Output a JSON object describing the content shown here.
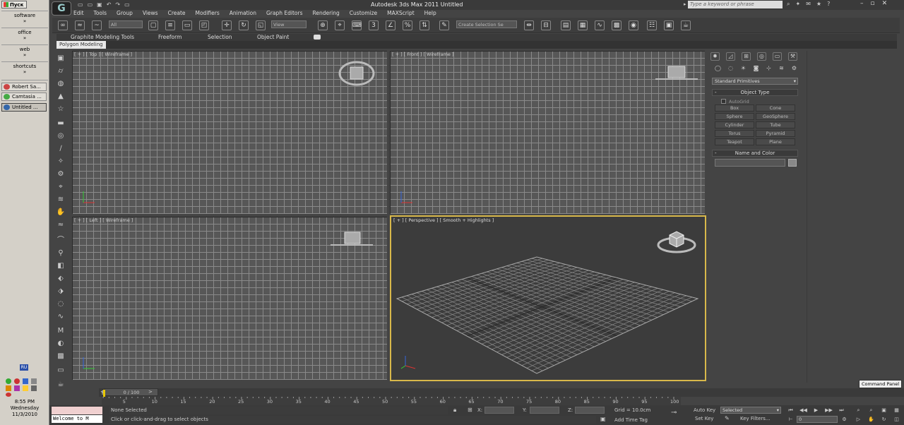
{
  "taskbar": {
    "start_label": "Пуск",
    "groups": [
      {
        "label": "software",
        "chev": "»"
      },
      {
        "label": "office",
        "chev": "»"
      },
      {
        "label": "web",
        "chev": "»"
      },
      {
        "label": "shortcuts",
        "chev": "»"
      }
    ],
    "tasks": [
      {
        "label": "Robert Sa...",
        "color": "#c44"
      },
      {
        "label": "Camtasia ...",
        "color": "#4a4"
      },
      {
        "label": "Untitled ...",
        "color": "#36a"
      }
    ],
    "lang": "RU",
    "time": "8:55 PM",
    "day": "Wednesday",
    "date": "11/3/2010"
  },
  "window": {
    "title": "Autodesk 3ds Max  2011     Untitled",
    "search_placeholder": "Type a keyword or phrase",
    "menu": [
      "Edit",
      "Tools",
      "Group",
      "Views",
      "Create",
      "Modifiers",
      "Animation",
      "Graph Editors",
      "Rendering",
      "Customize",
      "MAXScript",
      "Help"
    ]
  },
  "toolbar": {
    "filter_value": "All",
    "refcoord_value": "View",
    "selset_placeholder": "Create Selection Se"
  },
  "ribbon": {
    "tabs": [
      "Graphite Modeling Tools",
      "Freeform",
      "Selection",
      "Object Paint"
    ],
    "panel_label": "Polygon Modeling"
  },
  "viewports": {
    "top": "[ + ] [ Top ] [ Wireframe ]",
    "front": "[ + ] [ Front ] [ Wireframe ]",
    "left": "[ + ] [ Left ] [ Wireframe ]",
    "perspective": "[ + ] [ Perspective ] [ Smooth + Highlights ]"
  },
  "command_panel": {
    "category": "Standard Primitives",
    "object_type_title": "Object Type",
    "autogrid": "AutoGrid",
    "primitives": [
      "Box",
      "Cone",
      "Sphere",
      "GeoSphere",
      "Cylinder",
      "Tube",
      "Torus",
      "Pyramid",
      "Teapot",
      "Plane"
    ],
    "name_color_title": "Name and Color",
    "tooltip": "Command Panel"
  },
  "timeline": {
    "frame_display": "0 / 100",
    "ticks": [
      "5",
      "10",
      "15",
      "20",
      "25",
      "30",
      "35",
      "40",
      "45",
      "50",
      "55",
      "60",
      "65",
      "70",
      "75",
      "80",
      "85",
      "90",
      "95",
      "100"
    ]
  },
  "status": {
    "listener": "Welcome to M",
    "selection": "None Selected",
    "prompt": "Click or click-and-drag to select objects",
    "x_label": "X:",
    "y_label": "Y:",
    "z_label": "Z:",
    "grid": "Grid = 10.0cm",
    "add_time_tag": "Add Time Tag",
    "auto_key": "Auto Key",
    "set_key": "Set Key",
    "selected_value": "Selected",
    "key_filters": "Key Filters...",
    "current_frame": "0"
  }
}
